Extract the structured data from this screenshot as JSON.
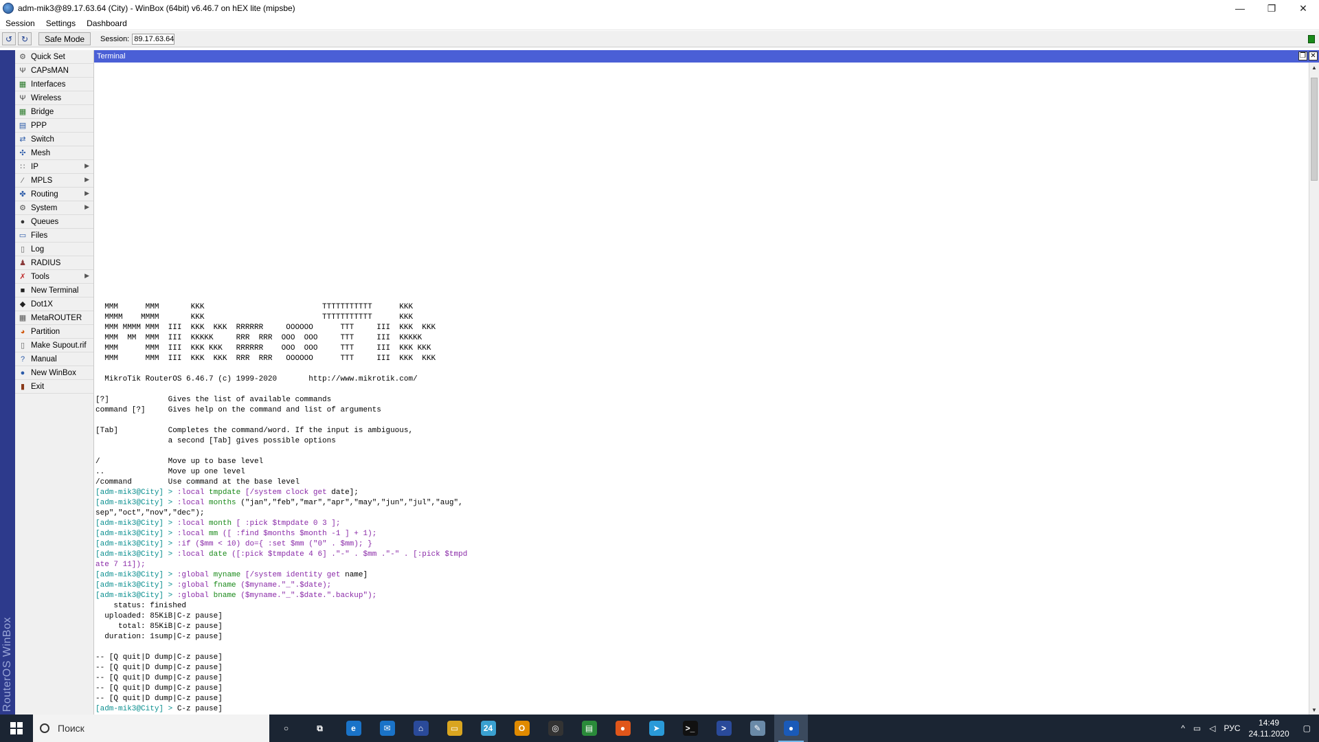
{
  "window": {
    "title": "adm-mik3@89.17.63.64 (City) - WinBox (64bit) v6.46.7 on hEX lite (mipsbe)",
    "controls": [
      "—",
      "❐",
      "✕"
    ]
  },
  "menubar": [
    "Session",
    "Settings",
    "Dashboard"
  ],
  "toolbar": {
    "undo_icon": "↺",
    "redo_icon": "↻",
    "safe_mode_label": "Safe Mode",
    "session_label": "Session:",
    "session_value": "89.17.63.64"
  },
  "brand": "RouterOS WinBox",
  "sidebar": {
    "items": [
      {
        "label": "Quick Set",
        "icon": "quickset-icon",
        "glyph": "⚙",
        "color": "#555",
        "arrow": false
      },
      {
        "label": "CAPsMAN",
        "icon": "capsman-icon",
        "glyph": "Ψ",
        "color": "#444",
        "arrow": false
      },
      {
        "label": "Interfaces",
        "icon": "interfaces-icon",
        "glyph": "▦",
        "color": "#2a7a2a",
        "arrow": false
      },
      {
        "label": "Wireless",
        "icon": "wireless-icon",
        "glyph": "Ψ",
        "color": "#444",
        "arrow": false
      },
      {
        "label": "Bridge",
        "icon": "bridge-icon",
        "glyph": "▦",
        "color": "#2a7a2a",
        "arrow": false
      },
      {
        "label": "PPP",
        "icon": "ppp-icon",
        "glyph": "▤",
        "color": "#2a5aa8",
        "arrow": false
      },
      {
        "label": "Switch",
        "icon": "switch-icon",
        "glyph": "⇄",
        "color": "#2a5aa8",
        "arrow": false
      },
      {
        "label": "Mesh",
        "icon": "mesh-icon",
        "glyph": "✣",
        "color": "#2a5aa8",
        "arrow": false
      },
      {
        "label": "IP",
        "icon": "ip-icon",
        "glyph": "∷",
        "color": "#555",
        "arrow": true
      },
      {
        "label": "MPLS",
        "icon": "mpls-icon",
        "glyph": "⁄",
        "color": "#555",
        "arrow": true
      },
      {
        "label": "Routing",
        "icon": "routing-icon",
        "glyph": "✤",
        "color": "#2a5aa8",
        "arrow": true
      },
      {
        "label": "System",
        "icon": "system-icon",
        "glyph": "⚙",
        "color": "#555",
        "arrow": true
      },
      {
        "label": "Queues",
        "icon": "queues-icon",
        "glyph": "●",
        "color": "#333",
        "arrow": false
      },
      {
        "label": "Files",
        "icon": "files-icon",
        "glyph": "▭",
        "color": "#2a5aa8",
        "arrow": false
      },
      {
        "label": "Log",
        "icon": "log-icon",
        "glyph": "▯",
        "color": "#666",
        "arrow": false
      },
      {
        "label": "RADIUS",
        "icon": "radius-icon",
        "glyph": "♟",
        "color": "#8a3a3a",
        "arrow": false
      },
      {
        "label": "Tools",
        "icon": "tools-icon",
        "glyph": "✗",
        "color": "#c03030",
        "arrow": true
      },
      {
        "label": "New Terminal",
        "icon": "terminal-icon",
        "glyph": "■",
        "color": "#222",
        "arrow": false
      },
      {
        "label": "Dot1X",
        "icon": "dot1x-icon",
        "glyph": "◆",
        "color": "#222",
        "arrow": false
      },
      {
        "label": "MetaROUTER",
        "icon": "metarouter-icon",
        "glyph": "▦",
        "color": "#555",
        "arrow": false
      },
      {
        "label": "Partition",
        "icon": "partition-icon",
        "glyph": "◕",
        "color": "#d05a10",
        "arrow": false
      },
      {
        "label": "Make Supout.rif",
        "icon": "supout-icon",
        "glyph": "▯",
        "color": "#666",
        "arrow": false
      },
      {
        "label": "Manual",
        "icon": "manual-icon",
        "glyph": "?",
        "color": "#2a5aa8",
        "arrow": false
      },
      {
        "label": "New WinBox",
        "icon": "winbox-icon",
        "glyph": "●",
        "color": "#2a5aa8",
        "arrow": false
      },
      {
        "label": "Exit",
        "icon": "exit-icon",
        "glyph": "▮",
        "color": "#8a3a1a",
        "arrow": false
      }
    ]
  },
  "terminal": {
    "title": "Terminal",
    "restore_icon": "❐",
    "close_icon": "✕",
    "lines": [
      [
        {
          "t": "  MMM      MMM       KKK                          TTTTTTTTTTT      KKK"
        }
      ],
      [
        {
          "t": "  MMMM    MMMM       KKK                          TTTTTTTTTTT      KKK"
        }
      ],
      [
        {
          "t": "  MMM MMMM MMM  III  KKK  KKK  RRRRRR     OOOOOO      TTT     III  KKK  KKK"
        }
      ],
      [
        {
          "t": "  MMM  MM  MMM  III  KKKKK     RRR  RRR  OOO  OOO     TTT     III  KKKKK"
        }
      ],
      [
        {
          "t": "  MMM      MMM  III  KKK KKK   RRRRRR    OOO  OOO     TTT     III  KKK KKK"
        }
      ],
      [
        {
          "t": "  MMM      MMM  III  KKK  KKK  RRR  RRR   OOOOOO      TTT     III  KKK  KKK"
        }
      ],
      [
        {
          "t": ""
        }
      ],
      [
        {
          "t": "  MikroTik RouterOS 6.46.7 (c) 1999-2020       http://www.mikrotik.com/"
        }
      ],
      [
        {
          "t": ""
        }
      ],
      [
        {
          "t": "[?]             Gives the list of available commands"
        }
      ],
      [
        {
          "t": "command [?]     Gives help on the command and list of arguments"
        }
      ],
      [
        {
          "t": ""
        }
      ],
      [
        {
          "t": "[Tab]           Completes the command/word. If the input is ambiguous,"
        }
      ],
      [
        {
          "t": "                a second [Tab] gives possible options"
        }
      ],
      [
        {
          "t": ""
        }
      ],
      [
        {
          "t": "/               Move up to base level"
        }
      ],
      [
        {
          "t": "..              Move up one level"
        }
      ],
      [
        {
          "t": "/command        Use command at the base level"
        }
      ],
      [
        {
          "t": "[adm-mik3@City] > ",
          "c": "c-teal"
        },
        {
          "t": ":local ",
          "c": "c-purple"
        },
        {
          "t": "tmpdate ",
          "c": "c-green"
        },
        {
          "t": "[/system clock get ",
          "c": "c-purple"
        },
        {
          "t": "date];"
        }
      ],
      [
        {
          "t": "[adm-mik3@City] > ",
          "c": "c-teal"
        },
        {
          "t": ":local ",
          "c": "c-purple"
        },
        {
          "t": "months ",
          "c": "c-green"
        },
        {
          "t": "(\"jan\",\"feb\",\"mar\",\"apr\",\"may\",\"jun\",\"jul\",\"aug\","
        }
      ],
      [
        {
          "t": "sep\",\"oct\",\"nov\",\"dec\");"
        }
      ],
      [
        {
          "t": "[adm-mik3@City] > ",
          "c": "c-teal"
        },
        {
          "t": ":local ",
          "c": "c-purple"
        },
        {
          "t": "month ",
          "c": "c-green"
        },
        {
          "t": "[ :pick $tmpdate 0 3 ];",
          "c": "c-purple"
        }
      ],
      [
        {
          "t": "[adm-mik3@City] > ",
          "c": "c-teal"
        },
        {
          "t": ":local ",
          "c": "c-purple"
        },
        {
          "t": "mm ",
          "c": "c-green"
        },
        {
          "t": "([ :find $months $month -1 ] + 1);",
          "c": "c-purple"
        }
      ],
      [
        {
          "t": "[adm-mik3@City] > ",
          "c": "c-teal"
        },
        {
          "t": ":if ",
          "c": "c-purple"
        },
        {
          "t": "($mm < 10) do={ :set $mm (\"0\" . $mm); }",
          "c": "c-purple"
        }
      ],
      [
        {
          "t": "[adm-mik3@City] > ",
          "c": "c-teal"
        },
        {
          "t": ":local ",
          "c": "c-purple"
        },
        {
          "t": "date ",
          "c": "c-green"
        },
        {
          "t": "([:pick $tmpdate 4 6] .\"-\" . $mm .\"-\" . [:pick $tmpd",
          "c": "c-purple"
        }
      ],
      [
        {
          "t": "ate 7 11]);",
          "c": "c-purple"
        }
      ],
      [
        {
          "t": "[adm-mik3@City] > ",
          "c": "c-teal"
        },
        {
          "t": ":global ",
          "c": "c-purple"
        },
        {
          "t": "myname ",
          "c": "c-green"
        },
        {
          "t": "[/system identity get ",
          "c": "c-purple"
        },
        {
          "t": "name]"
        }
      ],
      [
        {
          "t": "[adm-mik3@City] > ",
          "c": "c-teal"
        },
        {
          "t": ":global ",
          "c": "c-purple"
        },
        {
          "t": "fname ",
          "c": "c-green"
        },
        {
          "t": "($myname.\"_\".$date);",
          "c": "c-purple"
        }
      ],
      [
        {
          "t": "[adm-mik3@City] > ",
          "c": "c-teal"
        },
        {
          "t": ":global ",
          "c": "c-purple"
        },
        {
          "t": "bname ",
          "c": "c-green"
        },
        {
          "t": "($myname.\"_\".$date.\".backup\");",
          "c": "c-purple"
        }
      ],
      [
        {
          "t": "    status: finished"
        }
      ],
      [
        {
          "t": "  uploaded: 85KiB|C-z pause]"
        }
      ],
      [
        {
          "t": "     total: 85KiB|C-z pause]"
        }
      ],
      [
        {
          "t": "  duration: 1sump|C-z pause]"
        }
      ],
      [
        {
          "t": ""
        }
      ],
      [
        {
          "t": "-- [Q quit|D dump|C-z pause]"
        }
      ],
      [
        {
          "t": "-- [Q quit|D dump|C-z pause]"
        }
      ],
      [
        {
          "t": "-- [Q quit|D dump|C-z pause]"
        }
      ],
      [
        {
          "t": "-- [Q quit|D dump|C-z pause]"
        }
      ],
      [
        {
          "t": "-- [Q quit|D dump|C-z pause]"
        }
      ],
      [
        {
          "t": "[adm-mik3@City] > ",
          "c": "c-teal"
        },
        {
          "t": "C-z pause]"
        }
      ]
    ]
  },
  "taskbar": {
    "search_placeholder": "Поиск",
    "apps": [
      {
        "name": "cortana-icon",
        "glyph": "○",
        "bg": "transparent"
      },
      {
        "name": "task-view-icon",
        "glyph": "⧉",
        "bg": "transparent"
      },
      {
        "name": "edge-icon",
        "glyph": "e",
        "bg": "#1a73c8"
      },
      {
        "name": "mail-icon",
        "glyph": "✉",
        "bg": "#1a73c8"
      },
      {
        "name": "network-app-icon",
        "glyph": "⌂",
        "bg": "#2a4a9a"
      },
      {
        "name": "explorer-icon",
        "glyph": "▭",
        "bg": "#d9a520"
      },
      {
        "name": "app-24-icon",
        "glyph": "24",
        "bg": "#3aa0d0"
      },
      {
        "name": "outlook-icon",
        "glyph": "O",
        "bg": "#e08a00"
      },
      {
        "name": "keepass-icon",
        "glyph": "◎",
        "bg": "#333"
      },
      {
        "name": "notes-icon",
        "glyph": "▤",
        "bg": "#2a8a3a"
      },
      {
        "name": "firefox-icon",
        "glyph": "●",
        "bg": "#e0561a"
      },
      {
        "name": "telegram-icon",
        "glyph": "➤",
        "bg": "#2a9ad8"
      },
      {
        "name": "cmd-icon",
        "glyph": ">_",
        "bg": "#111"
      },
      {
        "name": "powershell-icon",
        "glyph": ">",
        "bg": "#2a4a9a"
      },
      {
        "name": "editor-icon",
        "glyph": "✎",
        "bg": "#6a8aa8"
      },
      {
        "name": "winbox-task-icon",
        "glyph": "●",
        "bg": "#1a5ab8"
      }
    ],
    "tray_chevron": "^",
    "network_icon": "▭",
    "volume_icon": "◁",
    "language": "РУС",
    "time": "14:49",
    "date": "24.11.2020",
    "notifications_icon": "▢"
  }
}
